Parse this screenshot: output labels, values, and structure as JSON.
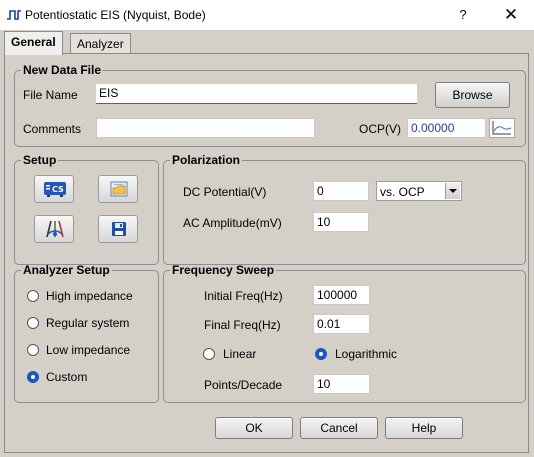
{
  "window": {
    "title": "Potentiostatic EIS (Nyquist, Bode)",
    "help": "?",
    "close": "✕"
  },
  "tabs": [
    {
      "label": "General",
      "active": true
    },
    {
      "label": "Analyzer",
      "active": false
    }
  ],
  "new_data_file": {
    "legend": "New Data File",
    "file_name_label": "File Name",
    "file_name_value": "EIS",
    "browse_label": "Browse",
    "comments_label": "Comments",
    "comments_value": "",
    "ocp_label": "OCP(V)",
    "ocp_value": "0.00000"
  },
  "setup": {
    "legend": "Setup",
    "buttons": [
      "cs-instrument-icon",
      "open-folder-icon",
      "cell-electrodes-icon",
      "save-disk-icon"
    ]
  },
  "polarization": {
    "legend": "Polarization",
    "dc_label": "DC Potential(V)",
    "dc_value": "0",
    "reference": "vs. OCP",
    "ac_label": "AC Amplitude(mV)",
    "ac_value": "10"
  },
  "analyzer_setup": {
    "legend": "Analyzer Setup",
    "options": [
      {
        "label": "High impedance",
        "selected": false
      },
      {
        "label": "Regular system",
        "selected": false
      },
      {
        "label": "Low impedance",
        "selected": false
      },
      {
        "label": "Custom",
        "selected": true
      }
    ]
  },
  "frequency_sweep": {
    "legend": "Frequency Sweep",
    "initial_label": "Initial Freq(Hz)",
    "initial_value": "100000",
    "final_label": "Final Freq(Hz)",
    "final_value": "0.01",
    "linear_label": "Linear",
    "logarithmic_label": "Logarithmic",
    "scale_selected": "Logarithmic",
    "points_label": "Points/Decade",
    "points_value": "10"
  },
  "footer": {
    "ok": "OK",
    "cancel": "Cancel",
    "help": "Help"
  },
  "colors": {
    "dialog_bg": "#d4d0c8",
    "accent_blue": "#1a56c8",
    "ocp_text": "#1f3fb3"
  }
}
